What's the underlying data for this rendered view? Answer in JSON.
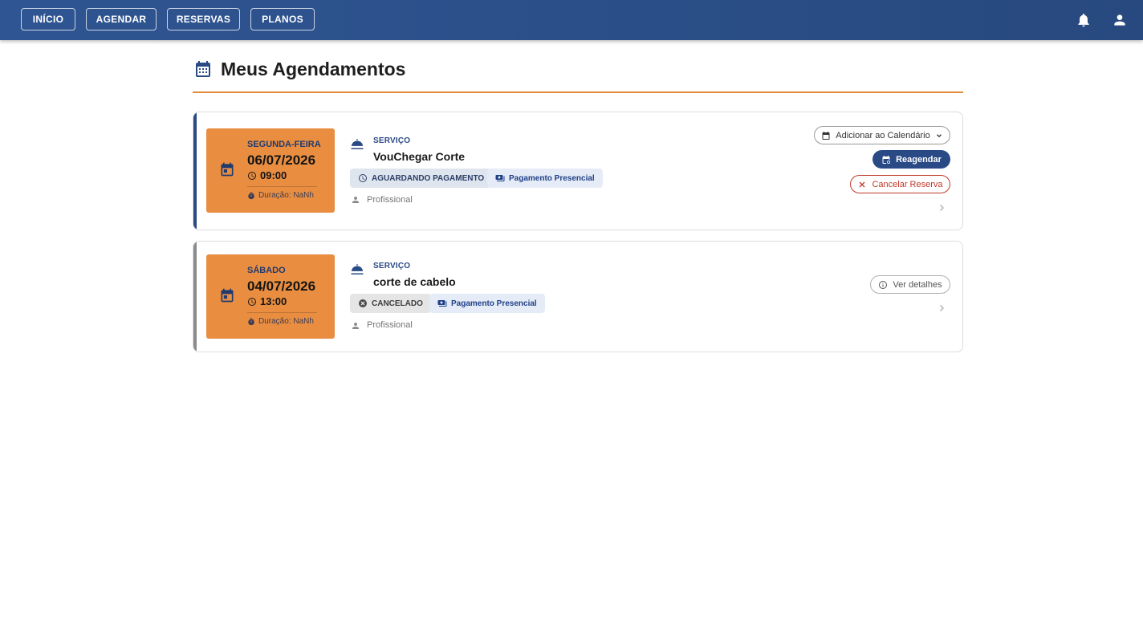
{
  "nav": {
    "items": [
      {
        "label": "INÍCIO"
      },
      {
        "label": "AGENDAR"
      },
      {
        "label": "RESERVAS"
      },
      {
        "label": "PLANOS"
      }
    ],
    "icons": [
      "bell-icon",
      "person-icon"
    ]
  },
  "page": {
    "title": "Meus Agendamentos",
    "title_icon": "calendar-icon",
    "accent_color": "#e08a3c"
  },
  "appointments": [
    {
      "weekday": "SEGUNDA-FEIRA",
      "date": "06/07/2026",
      "time": "09:00",
      "duration": "Duração: NaNh",
      "service_label": "SERVIÇO",
      "service_name": "VouChegar Corte",
      "status": "AGUARDANDO PAGAMENTO",
      "payment": "Pagamento Presencial",
      "professional": "Profissional",
      "accent_color": "#2a4a86",
      "actions": {
        "add_calendar": "Adicionar ao Calendário",
        "reschedule": "Reagendar",
        "cancel": "Cancelar Reserva"
      }
    },
    {
      "weekday": "SÁBADO",
      "date": "04/07/2026",
      "time": "13:00",
      "duration": "Duração: NaNh",
      "service_label": "SERVIÇO",
      "service_name": "corte de cabelo",
      "status": "CANCELADO",
      "payment": "Pagamento Presencial",
      "professional": "Profissional",
      "accent_color": "#8c8c8c",
      "actions": {
        "details": "Ver detalhes"
      }
    }
  ],
  "colors": {
    "header": "#2a4a86",
    "date_box": "#e98e41",
    "danger": "#c0392b"
  }
}
